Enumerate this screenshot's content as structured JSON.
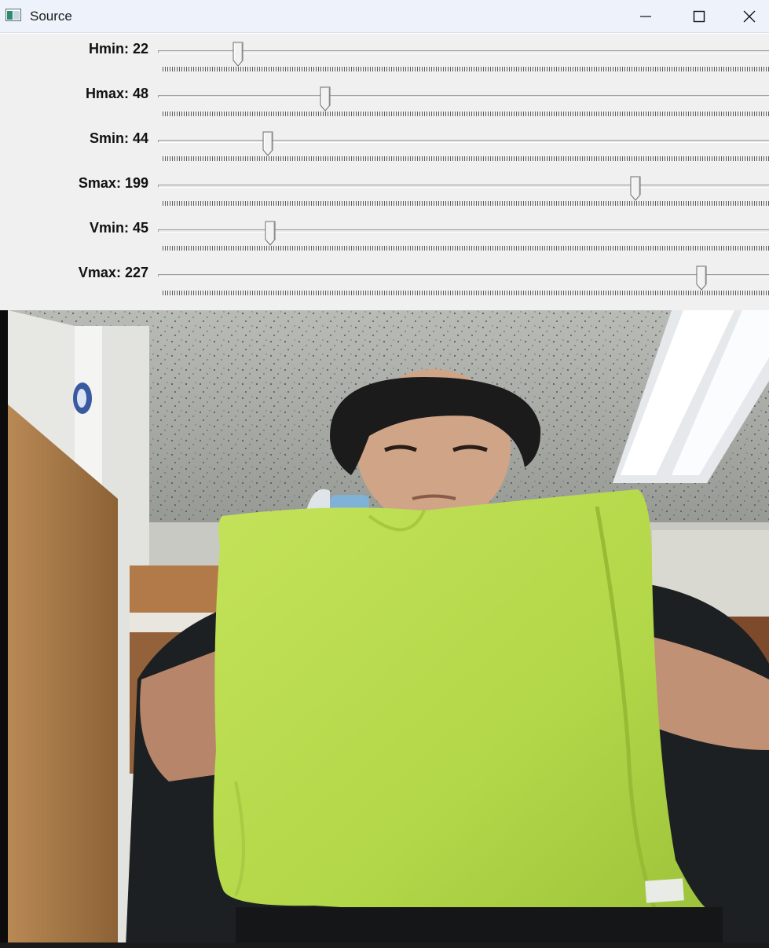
{
  "window": {
    "title": "Source",
    "icon": "opencv-window-icon",
    "controls": [
      "minimize-icon",
      "maximize-icon",
      "close-icon"
    ]
  },
  "trackbars": [
    {
      "name": "Hmin",
      "value": "22",
      "max": 179
    },
    {
      "name": "Hmax",
      "value": "48",
      "max": 179
    },
    {
      "name": "Smin",
      "value": "44",
      "max": 255
    },
    {
      "name": "Smax",
      "value": "199",
      "max": 255
    },
    {
      "name": "Vmin",
      "value": "45",
      "max": 255
    },
    {
      "name": "Vmax",
      "value": "227",
      "max": 255
    }
  ],
  "video": {
    "description_icon": "camera-frame",
    "accent_color": "#b5db4a"
  }
}
